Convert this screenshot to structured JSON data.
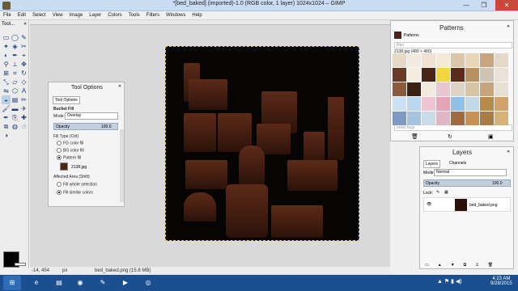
{
  "window": {
    "title": "*[bed_baked] (imported)-1.0 (RGB color, 1 layer) 1024x1024 – GIMP",
    "controls": [
      "—",
      "❐",
      "✕"
    ]
  },
  "menu": [
    "File",
    "Edit",
    "Select",
    "View",
    "Image",
    "Layer",
    "Colors",
    "Tools",
    "Filters",
    "Windows",
    "Help"
  ],
  "toolbox": {
    "title": "Tool...",
    "close": "✕",
    "tools": [
      {
        "icon": "rect-select-icon",
        "glyph": "▭"
      },
      {
        "icon": "ellipse-select-icon",
        "glyph": "◯"
      },
      {
        "icon": "free-select-icon",
        "glyph": "✎"
      },
      {
        "icon": "fuzzy-select-icon",
        "glyph": "✦"
      },
      {
        "icon": "color-select-icon",
        "glyph": "◈"
      },
      {
        "icon": "scissors-select-icon",
        "glyph": "✂"
      },
      {
        "icon": "foreground-select-icon",
        "glyph": "◐"
      },
      {
        "icon": "paths-icon",
        "glyph": "✒"
      },
      {
        "icon": "color-picker-icon",
        "glyph": "⌖"
      },
      {
        "icon": "zoom-icon",
        "glyph": "⚲"
      },
      {
        "icon": "measure-icon",
        "glyph": "⟂"
      },
      {
        "icon": "move-icon",
        "glyph": "✥"
      },
      {
        "icon": "align-icon",
        "glyph": "⊞"
      },
      {
        "icon": "crop-icon",
        "glyph": "⌗"
      },
      {
        "icon": "rotate-icon",
        "glyph": "↻"
      },
      {
        "icon": "scale-icon",
        "glyph": "⤡"
      },
      {
        "icon": "shear-icon",
        "glyph": "▱"
      },
      {
        "icon": "perspective-icon",
        "glyph": "◇"
      },
      {
        "icon": "flip-icon",
        "glyph": "⇋"
      },
      {
        "icon": "cage-icon",
        "glyph": "⬡"
      },
      {
        "icon": "text-icon",
        "glyph": "A"
      },
      {
        "icon": "bucket-fill-icon",
        "glyph": "◒"
      },
      {
        "icon": "blend-icon",
        "glyph": "▤"
      },
      {
        "icon": "pencil-icon",
        "glyph": "✏"
      },
      {
        "icon": "paintbrush-icon",
        "glyph": "🖌"
      },
      {
        "icon": "eraser-icon",
        "glyph": "▬"
      },
      {
        "icon": "airbrush-icon",
        "glyph": "✈"
      },
      {
        "icon": "ink-icon",
        "glyph": "✒"
      },
      {
        "icon": "clone-icon",
        "glyph": "⎘"
      },
      {
        "icon": "heal-icon",
        "glyph": "✚"
      },
      {
        "icon": "perspective-clone-icon",
        "glyph": "⧉"
      },
      {
        "icon": "blur-icon",
        "glyph": "◍"
      },
      {
        "icon": "smudge-icon",
        "glyph": "☝"
      },
      {
        "icon": "dodge-burn-icon",
        "glyph": "◑"
      }
    ]
  },
  "tool_options": {
    "title": "Tool Options",
    "tab": "Tool Options",
    "tool_name": "Bucket Fill",
    "mode_label": "Mode:",
    "mode_value": "Overlay",
    "opacity_label": "Opacity",
    "opacity_value": "100.0",
    "fill_type_label": "Fill Type  (Ctrl)",
    "fill_options": [
      "FG color fill",
      "BG color fill",
      "Pattern fill"
    ],
    "fill_selected": 2,
    "pattern_name": "2138.jpg",
    "affected_label": "Affected Area  (Shift)",
    "affected_options": [
      "Fill whole selection",
      "Fill similar colors"
    ],
    "affected_selected": 1
  },
  "patterns": {
    "title": "Patterns",
    "tab": "Patterns",
    "filter_placeholder": "filter",
    "current": "2138.jpg (480 × 480)",
    "tag_placeholder": "enter tags",
    "colors": [
      "#e6d9c8",
      "#f1eadf",
      "#efe2d2",
      "#f5e9d7",
      "#d9c7a8",
      "#e8d6b9",
      "#c9a57f",
      "#e5d8c8",
      "#6b3a25",
      "#f3ecdf",
      "#4a2416",
      "#f2d640",
      "#5a2a1b",
      "#b99062",
      "#cfc3b2",
      "#eae2d8",
      "#8a5a3a",
      "#3b2014",
      "#f1e9dc",
      "#e9c6cf",
      "#ddd2c4",
      "#d8c3a5",
      "#c6a57d",
      "#e6e0d4",
      "#c9e1f2",
      "#b9d6ee",
      "#f0c3d1",
      "#e4a3b7",
      "#8fc1e6",
      "#c2d9e8",
      "#b88a4a",
      "#d0a469",
      "#7b9ac4",
      "#a6c4df",
      "#c9dbe6",
      "#e1b4c6",
      "#9d6b3f",
      "#c89254",
      "#a87a45",
      "#d6b17a"
    ]
  },
  "layers": {
    "title": "Layers",
    "tabs": [
      "Layers",
      "Channels"
    ],
    "mode_label": "Mode:",
    "mode_value": "Normal",
    "opacity_label": "Opacity",
    "opacity_value": "100.0",
    "lock_label": "Lock:",
    "layer_name": "bed_baked.png"
  },
  "status": {
    "coords": "-14, 454",
    "unit": "px",
    "zoom": "",
    "message": "bed_baked.png (15.8 MB)"
  },
  "taskbar": {
    "time": "4:23 AM",
    "date": "9/28/2015"
  }
}
